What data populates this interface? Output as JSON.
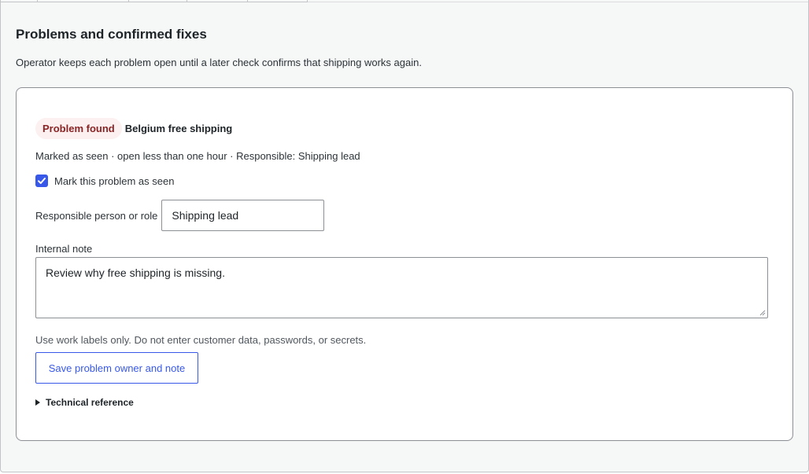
{
  "section": {
    "title": "Problems and confirmed fixes",
    "description": "Operator keeps each problem open until a later check confirms that shipping works again."
  },
  "problem": {
    "status_badge": "Problem found",
    "title": "Belgium free shipping",
    "meta": "Marked as seen · open less than one hour · Responsible: Shipping lead",
    "seen_checkbox": {
      "label": "Mark this problem as seen",
      "checked": true
    },
    "responsible": {
      "label": "Responsible person or role",
      "value": "Shipping lead"
    },
    "note": {
      "label": "Internal note",
      "value": "Review why free shipping is missing."
    },
    "help_text": "Use work labels only. Do not enter customer data, passwords, or secrets.",
    "save_button": "Save problem owner and note",
    "technical_reference": "Technical reference"
  },
  "colors": {
    "accent": "#3858e9",
    "badge_bg": "#fcf0f1",
    "badge_text": "#8a2424",
    "panel_bg": "#f6f7f7"
  },
  "icons": [
    "checkmark-icon",
    "disclosure-triangle-icon",
    "resize-grip-icon"
  ]
}
